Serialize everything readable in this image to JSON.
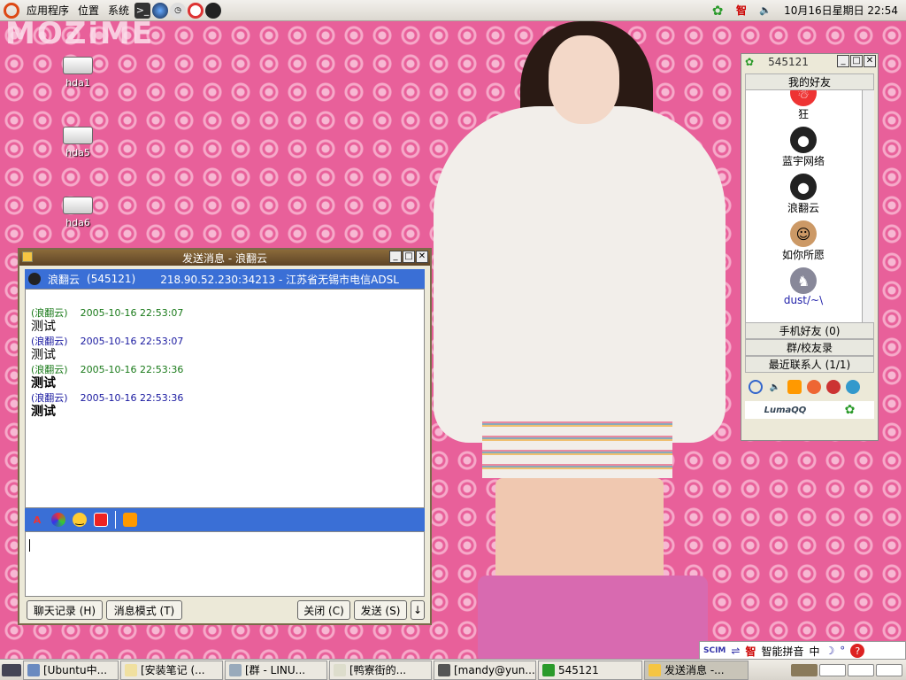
{
  "top_panel": {
    "menus": [
      "应用程序",
      "位置",
      "系统"
    ],
    "tray_text": "智",
    "clock": "10月16日星期日 22:54"
  },
  "desktop": {
    "logo": "MOZiME",
    "icons": [
      {
        "label": "hda1"
      },
      {
        "label": "hda5"
      },
      {
        "label": "hda6"
      }
    ]
  },
  "chat_window": {
    "title": "发送消息 - 浪翻云",
    "contact_name": "浪翻云",
    "contact_id": "(545121)",
    "contact_addr": "218.90.52.230:34213 - 江苏省无锡市电信ADSL",
    "messages": [
      {
        "sender": "(浪翻云)",
        "time": "2005-10-16 22:53:07",
        "text": "测试",
        "bold": false,
        "color": "#1a7a1a"
      },
      {
        "sender": "(浪翻云)",
        "time": "2005-10-16 22:53:07",
        "text": "测试",
        "bold": false,
        "color": "#1a1aa0"
      },
      {
        "sender": "(浪翻云)",
        "time": "2005-10-16 22:53:36",
        "text": "测试",
        "bold": true,
        "color": "#1a7a1a"
      },
      {
        "sender": "(浪翻云)",
        "time": "2005-10-16 22:53:36",
        "text": "测试",
        "bold": true,
        "color": "#1a1aa0"
      }
    ],
    "input_value": "",
    "history_button": "聊天记录 (H)",
    "mode_button": "消息模式 (T)",
    "close_button": "关闭 (C)",
    "send_button": "发送 (S)",
    "arrow_button": "↓"
  },
  "qq_window": {
    "title": "545121",
    "group_friends": "我的好友",
    "buddies": [
      {
        "name": "狂",
        "avatar": "santa-avatar-icon"
      },
      {
        "name": "蓝宇网络",
        "avatar": "penguin-avatar-icon"
      },
      {
        "name": "浪翻云",
        "avatar": "penguin-avatar-icon"
      },
      {
        "name": "如你所愿",
        "avatar": "man-avatar-icon"
      },
      {
        "name": "dust/~\\",
        "avatar": "cat-avatar-icon"
      }
    ],
    "group_mobile": "手机好友 (0)",
    "group_school": "群/校友录",
    "group_recent": "最近联系人 (1/1)",
    "footer_brand": "LumaQQ"
  },
  "ime_bar": {
    "label": "智能拼音",
    "mode": "中"
  },
  "taskbar": {
    "tasks": [
      {
        "label": "[Ubuntu中...",
        "active": false
      },
      {
        "label": "[安装笔记 (...",
        "active": false
      },
      {
        "label": "[群 - LINU...",
        "active": false
      },
      {
        "label": "[鸭寮街的...",
        "active": false
      },
      {
        "label": "[mandy@yun...",
        "active": false
      },
      {
        "label": "545121",
        "active": false
      },
      {
        "label": "发送消息 -...",
        "active": true
      }
    ]
  },
  "colors": {
    "wallpaper": "#e8609a",
    "chat_header": "#3a6fd6",
    "title_bar": "#6e5230"
  }
}
